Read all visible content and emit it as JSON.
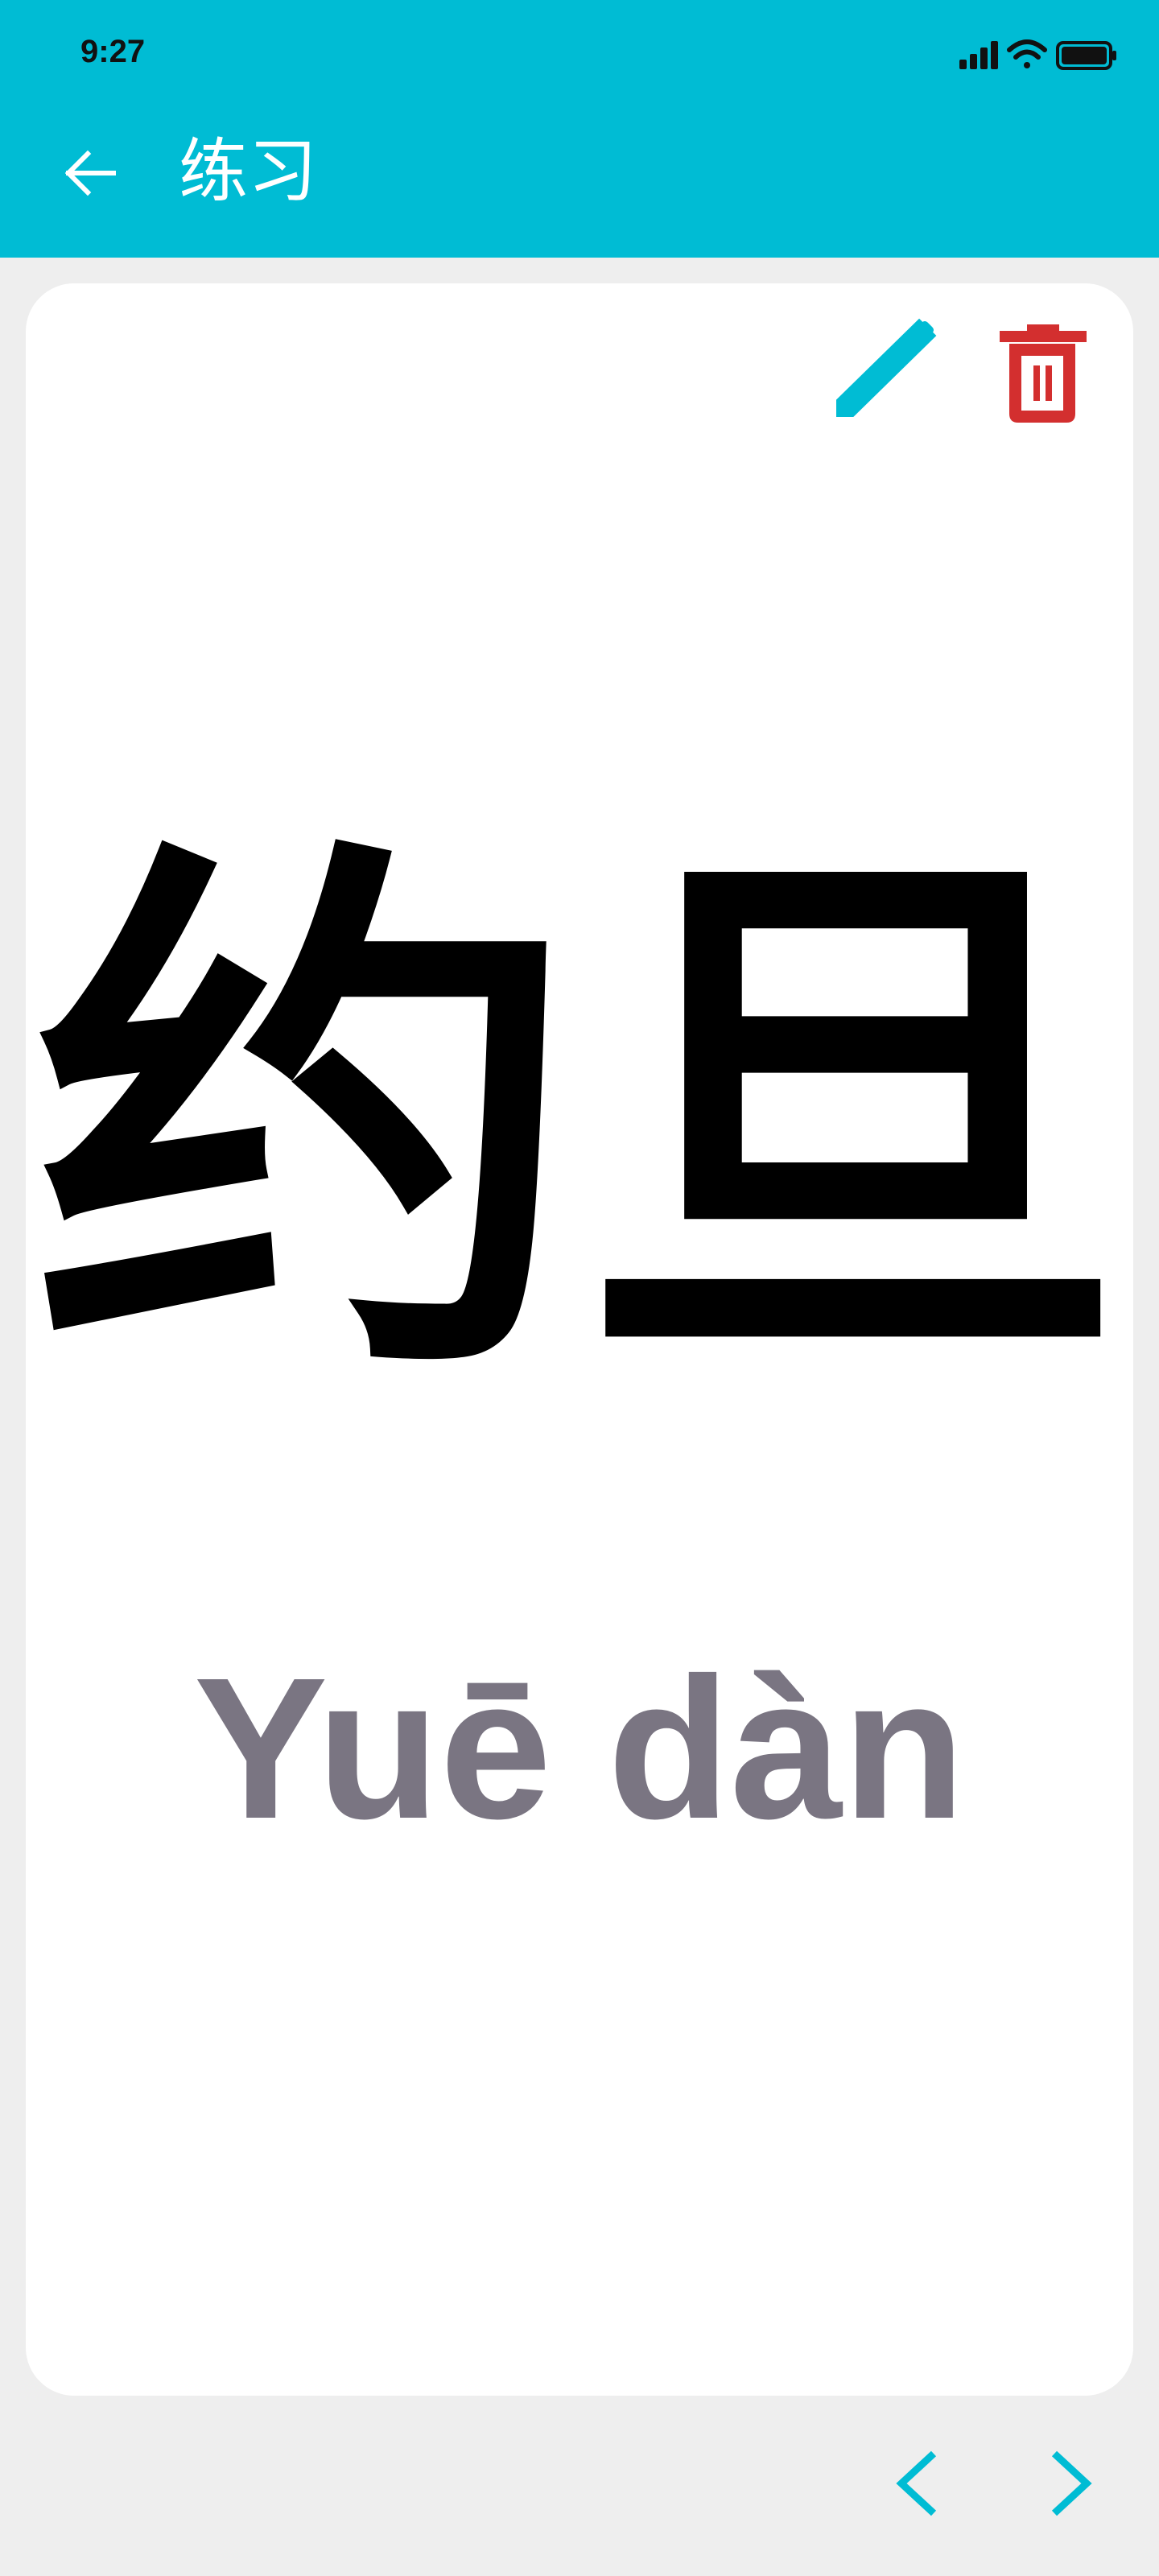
{
  "status_bar": {
    "time": "9:27"
  },
  "header": {
    "title": "练习",
    "back_icon": "arrow-left-icon"
  },
  "card": {
    "hanzi": "约旦",
    "pinyin": "Yuē dàn",
    "edit_icon": "pencil-icon",
    "delete_icon": "trash-icon"
  },
  "navigation": {
    "prev_icon": "chevron-left-icon",
    "next_icon": "chevron-right-icon"
  },
  "colors": {
    "header": "#00bcd4",
    "background": "#eeeeee",
    "card": "#ffffff",
    "edit": "#00bcd4",
    "delete": "#d32f2f",
    "pinyin": "#7a7582",
    "nav": "#00bcd4"
  }
}
